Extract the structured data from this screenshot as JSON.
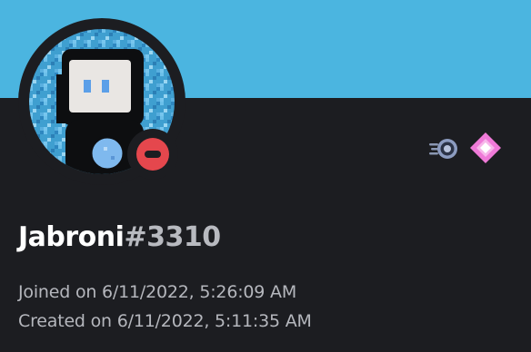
{
  "profile": {
    "username": "Jabroni",
    "discriminator": "#3310",
    "status": "do-not-disturb",
    "joined_text": "Joined on 6/11/2022, 5:26:09 AM",
    "created_text": "Created on 6/11/2022, 5:11:35 AM"
  },
  "avatar": {
    "icon": "pixel-character-avatar"
  },
  "badges": [
    {
      "name": "hypesquad-balance-badge",
      "icon": "swoosh-ring-icon"
    },
    {
      "name": "nitro-gem-badge",
      "icon": "pink-diamond-icon"
    }
  ],
  "colors": {
    "banner": "#4bb5e0",
    "background": "#1c1d21",
    "dnd": "#e5474d",
    "username": "#ffffff",
    "discriminator": "#b8bac0",
    "meta_text": "#b5b7bd",
    "badge_pink": "#ef7ad8"
  }
}
